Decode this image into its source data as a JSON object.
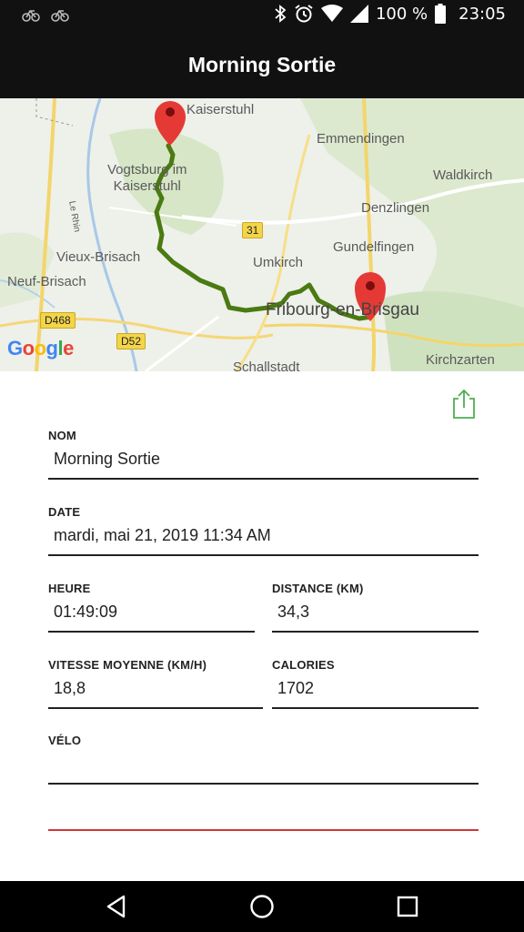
{
  "status_bar": {
    "battery_percent": "100 %",
    "time": "23:05",
    "left_icons": [
      "bike-icon",
      "bike-icon"
    ],
    "right_icons": [
      "bluetooth-icon",
      "alarm-icon",
      "wifi-icon",
      "signal-icon",
      "battery-icon"
    ]
  },
  "app_bar": {
    "title": "Morning Sortie"
  },
  "map": {
    "labels": {
      "kaiserstuhl": "Kaiserstuhl",
      "vogtsburg": "Vogtsburg im\nKaiserstuhl",
      "emmendingen": "Emmendingen",
      "waldkirch": "Waldkirch",
      "denzlingen": "Denzlingen",
      "gundelfingen": "Gundelfingen",
      "vieux_brisach": "Vieux-Brisach",
      "umkirch": "Umkirch",
      "neuf_brisach": "Neuf-Brisach",
      "fribourg": "Fribourg-en-Brisgau",
      "schallstadt": "Schallstadt",
      "kirchzarten": "Kirchzarten",
      "le_rhin": "Le Rhin"
    },
    "road_badges": {
      "r31": "31",
      "d468": "D468",
      "d52": "D52"
    },
    "attribution": "Google",
    "route_color": "#4a7a12",
    "marker_color": "#e53935"
  },
  "form": {
    "nom": {
      "label": "NOM",
      "value": "Morning Sortie"
    },
    "date": {
      "label": "DATE",
      "value": "mardi, mai 21, 2019 11:34 AM"
    },
    "heure": {
      "label": "HEURE",
      "value": "01:49:09"
    },
    "distance": {
      "label": "DISTANCE (KM)",
      "value": "34,3"
    },
    "vitesse": {
      "label": "VITESSE MOYENNE (KM/H)",
      "value": "18,8"
    },
    "calories": {
      "label": "CALORIES",
      "value": "1702"
    },
    "velo": {
      "label": "VÉLO",
      "value": ""
    }
  },
  "colors": {
    "share_accent": "#4caf50",
    "error_line": "#d23535"
  },
  "nav_bar": {
    "icons": [
      "back-icon",
      "home-icon",
      "recents-icon"
    ]
  }
}
